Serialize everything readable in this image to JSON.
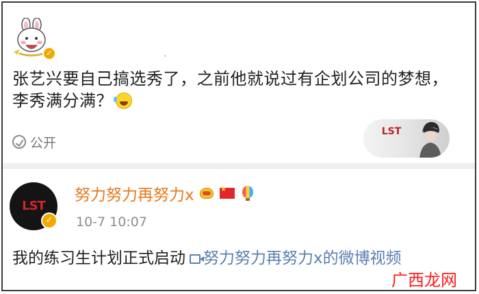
{
  "post1": {
    "text": "张艺兴要自己搞选秀了，之前他就说过有企划公司的梦想，李秀满分满？",
    "emoji": "laughing-tears",
    "visibility_label": "公开",
    "avatar_icon": "bunny-avatar",
    "verify_icon": "verified-badge"
  },
  "post2": {
    "username": "努力努力再努力x",
    "badges": [
      "crown-icon",
      "china-flag-icon",
      "balloon-icon"
    ],
    "timestamp": "10-7 10:07",
    "text": "我的练习生计划正式启动",
    "video_link": "努力努力再努力x的微博视频",
    "avatar_text": "LST"
  },
  "thumbnail": {
    "logo_text": "LST"
  },
  "watermark": "广西龙网",
  "colors": {
    "username": "#e8791b",
    "link": "#5a7fb0",
    "watermark": "#ff1a1a",
    "verify": "#f2a900"
  }
}
